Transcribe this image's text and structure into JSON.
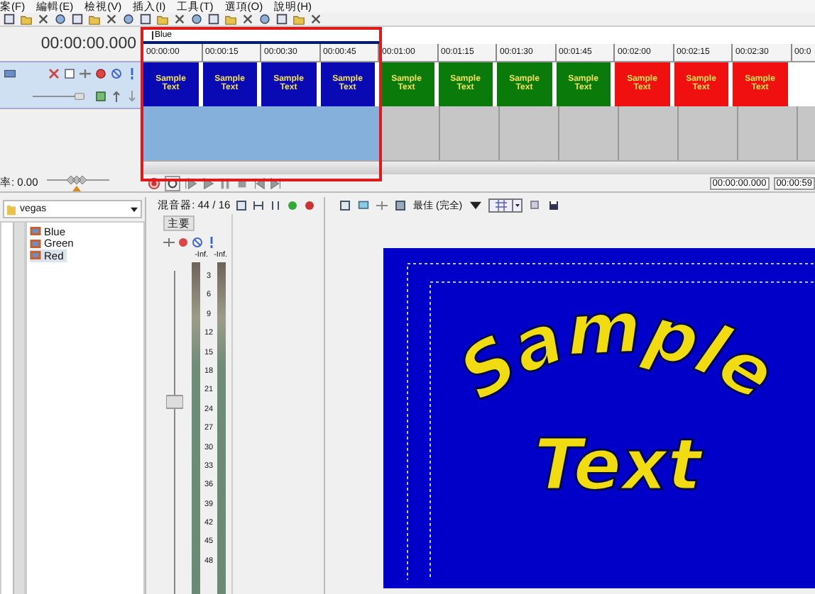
{
  "menu": [
    "案(F)",
    "編輯(E)",
    "檢視(V)",
    "插入(I)",
    "工具(T)",
    "選項(O)",
    "說明(H)"
  ],
  "timeline": {
    "time": "00:00:00.000",
    "region_label": "Blue",
    "ruler": [
      "00:00:00",
      "00:00:15",
      "00:00:30",
      "00:00:45",
      "00:01:00",
      "00:01:15",
      "00:01:30",
      "00:01:45",
      "00:02:00",
      "00:02:15",
      "00:02:30",
      "00:0"
    ],
    "clips": [
      {
        "label": "Sample Text",
        "color": "#0a0ab4"
      },
      {
        "label": "Sample Text",
        "color": "#0a0ab4"
      },
      {
        "label": "Sample Text",
        "color": "#0a0ab4"
      },
      {
        "label": "Sample Text",
        "color": "#0a0ab4"
      },
      {
        "label": "Sample Text",
        "color": "#0a7a0a"
      },
      {
        "label": "Sample Text",
        "color": "#0a7a0a"
      },
      {
        "label": "Sample Text",
        "color": "#0a7a0a"
      },
      {
        "label": "Sample Text",
        "color": "#0a7a0a"
      },
      {
        "label": "Sample Text",
        "color": "#f01010"
      },
      {
        "label": "Sample Text",
        "color": "#f01010"
      },
      {
        "label": "Sample Text",
        "color": "#f01010"
      }
    ],
    "track_volume": {
      "level": 0.86
    },
    "rate_control": {
      "level": 0.5
    },
    "rate": "率: 0.00",
    "cursor_time": "00:00:00.000",
    "end_time": "00:00:59"
  },
  "explorer": {
    "folder": "vegas",
    "files": [
      {
        "name": "Blue",
        "selected": false
      },
      {
        "name": "Green",
        "selected": false
      },
      {
        "name": "Red",
        "selected": true
      }
    ]
  },
  "mixer": {
    "title": "混音器: 44 / 16",
    "bus": "主要",
    "peaks": [
      "-Inf.",
      "-Inf."
    ],
    "scale": [
      "3",
      "6",
      "9",
      "12",
      "15",
      "18",
      "21",
      "24",
      "27",
      "30",
      "33",
      "36",
      "39",
      "42",
      "45",
      "48"
    ]
  },
  "preview": {
    "quality": "最佳 (完全)",
    "title_lines": [
      "Sample",
      "Text"
    ]
  },
  "highlight": {
    "kind": "rectangle"
  }
}
